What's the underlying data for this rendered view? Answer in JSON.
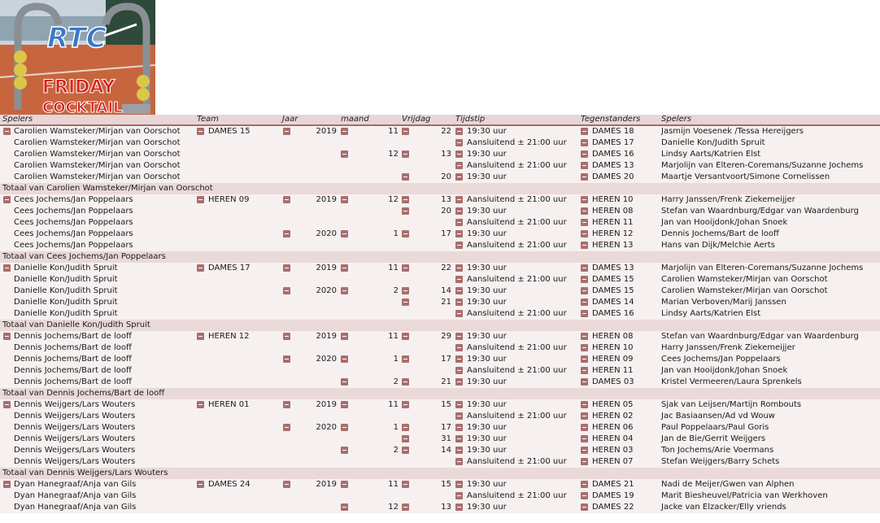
{
  "header": {
    "columns": [
      "Spelers",
      "Team",
      "Jaar",
      "maand",
      "Vrijdag",
      "Tijdstip",
      "Tegenstanders",
      "Spelers"
    ]
  },
  "logo": {
    "top_text": "RTC",
    "line1": "FRIDAY",
    "line2": "COCKTAIL"
  },
  "colors": {
    "toggle": "#a86f6f",
    "row": "#f7f0f0",
    "total_row": "#ead9d9",
    "header": "#e8d6d6"
  },
  "rows": [
    {
      "type": "d",
      "g": 1,
      "s": "Carolien Wamsteker/Mirjan van Oorschot",
      "team": "DAMES 15",
      "jaar": "2019",
      "maand": "11",
      "dag": "22",
      "tijd": "19:30 uur",
      "opp": "DAMES 18",
      "sp": "Jasmijn Voesenek /Tessa Hereijgers"
    },
    {
      "type": "d",
      "s": "Carolien Wamsteker/Mirjan van Oorschot",
      "team": "",
      "jaar": "",
      "maand": "",
      "dag": "",
      "tijd": "Aansluitend ± 21:00 uur",
      "opp": "DAMES 17",
      "sp": "Danielle Kon/Judith Spruit"
    },
    {
      "type": "d",
      "s": "Carolien Wamsteker/Mirjan van Oorschot",
      "team": "",
      "jaar": "",
      "maand": "12",
      "dag": "13",
      "tijd": "19:30 uur",
      "opp": "DAMES 16",
      "sp": "Lindsy Aarts/Katrien Elst"
    },
    {
      "type": "d",
      "s": "Carolien Wamsteker/Mirjan van Oorschot",
      "team": "",
      "jaar": "",
      "maand": "",
      "dag": "",
      "tijd": "Aansluitend ± 21:00 uur",
      "opp": "DAMES 13",
      "sp": "Marjolijn van Elteren-Coremans/Suzanne Jochems"
    },
    {
      "type": "d",
      "s": "Carolien Wamsteker/Mirjan van Oorschot",
      "team": "",
      "jaar": "",
      "maand": "",
      "dag": "20",
      "tijd": "19:30 uur",
      "opp": "DAMES 20",
      "sp": "Maartje Versantvoort/Simone Cornelissen"
    },
    {
      "type": "t",
      "label": "Totaal van Carolien Wamsteker/Mirjan van Oorschot"
    },
    {
      "type": "d",
      "g": 1,
      "s": "Cees Jochems/Jan Poppelaars",
      "team": "HEREN 09",
      "jaar": "2019",
      "maand": "12",
      "dag": "13",
      "tijd": "Aansluitend ± 21:00 uur",
      "opp": "HEREN 10",
      "sp": "Harry Janssen/Frenk Ziekemeijjer"
    },
    {
      "type": "d",
      "s": "Cees Jochems/Jan Poppelaars",
      "team": "",
      "jaar": "",
      "maand": "",
      "dag": "20",
      "tijd": "19:30 uur",
      "opp": "HEREN 08",
      "sp": "Stefan van Waardnburg/Edgar van Waardenburg"
    },
    {
      "type": "d",
      "s": "Cees Jochems/Jan Poppelaars",
      "team": "",
      "jaar": "",
      "maand": "",
      "dag": "",
      "tijd": "Aansluitend ± 21:00 uur",
      "opp": "HEREN 11",
      "sp": "Jan van Hooijdonk/Johan Snoek"
    },
    {
      "type": "d",
      "s": "Cees Jochems/Jan Poppelaars",
      "team": "",
      "jaar": "2020",
      "maand": "1",
      "dag": "17",
      "tijd": "19:30 uur",
      "opp": "HEREN 12",
      "sp": "Dennis Jochems/Bart de looff"
    },
    {
      "type": "d",
      "s": "Cees Jochems/Jan Poppelaars",
      "team": "",
      "jaar": "",
      "maand": "",
      "dag": "",
      "tijd": "Aansluitend ± 21:00 uur",
      "opp": "HEREN 13",
      "sp": "Hans van Dijk/Melchie Aerts"
    },
    {
      "type": "t",
      "label": "Totaal van Cees Jochems/Jan Poppelaars"
    },
    {
      "type": "d",
      "g": 1,
      "s": "Danielle Kon/Judith Spruit",
      "team": "DAMES 17",
      "jaar": "2019",
      "maand": "11",
      "dag": "22",
      "tijd": "19:30 uur",
      "opp": "DAMES 13",
      "sp": "Marjolijn van Elteren-Coremans/Suzanne Jochems"
    },
    {
      "type": "d",
      "s": "Danielle Kon/Judith Spruit",
      "team": "",
      "jaar": "",
      "maand": "",
      "dag": "",
      "tijd": "Aansluitend ± 21:00 uur",
      "opp": "DAMES 15",
      "sp": "Carolien Wamsteker/Mirjan van Oorschot"
    },
    {
      "type": "d",
      "s": "Danielle Kon/Judith Spruit",
      "team": "",
      "jaar": "2020",
      "maand": "2",
      "dag": "14",
      "tijd": "19:30 uur",
      "opp": "DAMES 15",
      "sp": "Carolien Wamsteker/Mirjan van Oorschot"
    },
    {
      "type": "d",
      "s": "Danielle Kon/Judith Spruit",
      "team": "",
      "jaar": "",
      "maand": "",
      "dag": "21",
      "tijd": "19:30 uur",
      "opp": "DAMES 14",
      "sp": "Marian Verboven/Marij Janssen"
    },
    {
      "type": "d",
      "s": "Danielle Kon/Judith Spruit",
      "team": "",
      "jaar": "",
      "maand": "",
      "dag": "",
      "tijd": "Aansluitend ± 21:00 uur",
      "opp": "DAMES 16",
      "sp": "Lindsy Aarts/Katrien Elst"
    },
    {
      "type": "t",
      "label": "Totaal van Danielle Kon/Judith Spruit"
    },
    {
      "type": "d",
      "g": 1,
      "s": "Dennis Jochems/Bart de looff",
      "team": "HEREN 12",
      "jaar": "2019",
      "maand": "11",
      "dag": "29",
      "tijd": "19:30 uur",
      "opp": "HEREN 08",
      "sp": "Stefan van Waardnburg/Edgar van Waardenburg"
    },
    {
      "type": "d",
      "s": "Dennis Jochems/Bart de looff",
      "team": "",
      "jaar": "",
      "maand": "",
      "dag": "",
      "tijd": "Aansluitend ± 21:00 uur",
      "opp": "HEREN 10",
      "sp": "Harry Janssen/Frenk Ziekemeijjer"
    },
    {
      "type": "d",
      "s": "Dennis Jochems/Bart de looff",
      "team": "",
      "jaar": "2020",
      "maand": "1",
      "dag": "17",
      "tijd": "19:30 uur",
      "opp": "HEREN 09",
      "sp": "Cees Jochems/Jan Poppelaars"
    },
    {
      "type": "d",
      "s": "Dennis Jochems/Bart de looff",
      "team": "",
      "jaar": "",
      "maand": "",
      "dag": "",
      "tijd": "Aansluitend ± 21:00 uur",
      "opp": "HEREN 11",
      "sp": "Jan van Hooijdonk/Johan Snoek"
    },
    {
      "type": "d",
      "s": "Dennis Jochems/Bart de looff",
      "team": "",
      "jaar": "",
      "maand": "2",
      "dag": "21",
      "tijd": "19:30 uur",
      "opp": "DAMES 03",
      "sp": "Kristel Vermeeren/Laura Sprenkels"
    },
    {
      "type": "t",
      "label": "Totaal van Dennis Jochems/Bart de looff"
    },
    {
      "type": "d",
      "g": 1,
      "s": "Dennis Weijgers/Lars Wouters",
      "team": "HEREN 01",
      "jaar": "2019",
      "maand": "11",
      "dag": "15",
      "tijd": "19:30 uur",
      "opp": "HEREN 05",
      "sp": "Sjak van Leijsen/Martijn Rombouts"
    },
    {
      "type": "d",
      "s": "Dennis Weijgers/Lars Wouters",
      "team": "",
      "jaar": "",
      "maand": "",
      "dag": "",
      "tijd": "Aansluitend ± 21:00 uur",
      "opp": "HEREN 02",
      "sp": "Jac Basiaansen/Ad vd Wouw"
    },
    {
      "type": "d",
      "s": "Dennis Weijgers/Lars Wouters",
      "team": "",
      "jaar": "2020",
      "maand": "1",
      "dag": "17",
      "tijd": "19:30 uur",
      "opp": "HEREN 06",
      "sp": "Paul Poppelaars/Paul Goris"
    },
    {
      "type": "d",
      "s": "Dennis Weijgers/Lars Wouters",
      "team": "",
      "jaar": "",
      "maand": "",
      "dag": "31",
      "tijd": "19:30 uur",
      "opp": "HEREN 04",
      "sp": "Jan de Bie/Gerrit Weijgers"
    },
    {
      "type": "d",
      "s": "Dennis Weijgers/Lars Wouters",
      "team": "",
      "jaar": "",
      "maand": "2",
      "dag": "14",
      "tijd": "19:30 uur",
      "opp": "HEREN 03",
      "sp": "Ton Jochems/Arie Voermans"
    },
    {
      "type": "d",
      "s": "Dennis Weijgers/Lars Wouters",
      "team": "",
      "jaar": "",
      "maand": "",
      "dag": "",
      "tijd": "Aansluitend ± 21:00 uur",
      "opp": "HEREN 07",
      "sp": "Stefan Weijgers/Barry Schets"
    },
    {
      "type": "t",
      "label": "Totaal van Dennis Weijgers/Lars Wouters"
    },
    {
      "type": "d",
      "g": 1,
      "s": "Dyan Hanegraaf/Anja van Gils",
      "team": "DAMES 24",
      "jaar": "2019",
      "maand": "11",
      "dag": "15",
      "tijd": "19:30 uur",
      "opp": "DAMES 21",
      "sp": "Nadi de Meijer/Gwen van Alphen"
    },
    {
      "type": "d",
      "s": "Dyan Hanegraaf/Anja van Gils",
      "team": "",
      "jaar": "",
      "maand": "",
      "dag": "",
      "tijd": "Aansluitend ± 21:00 uur",
      "opp": "DAMES 19",
      "sp": "Marit Biesheuvel/Patricia van Werkhoven"
    },
    {
      "type": "d",
      "s": "Dyan Hanegraaf/Anja van Gils",
      "team": "",
      "jaar": "",
      "maand": "12",
      "dag": "13",
      "tijd": "19:30 uur",
      "opp": "DAMES 22",
      "sp": "Jacke van Elzacker/Elly vriends"
    }
  ]
}
